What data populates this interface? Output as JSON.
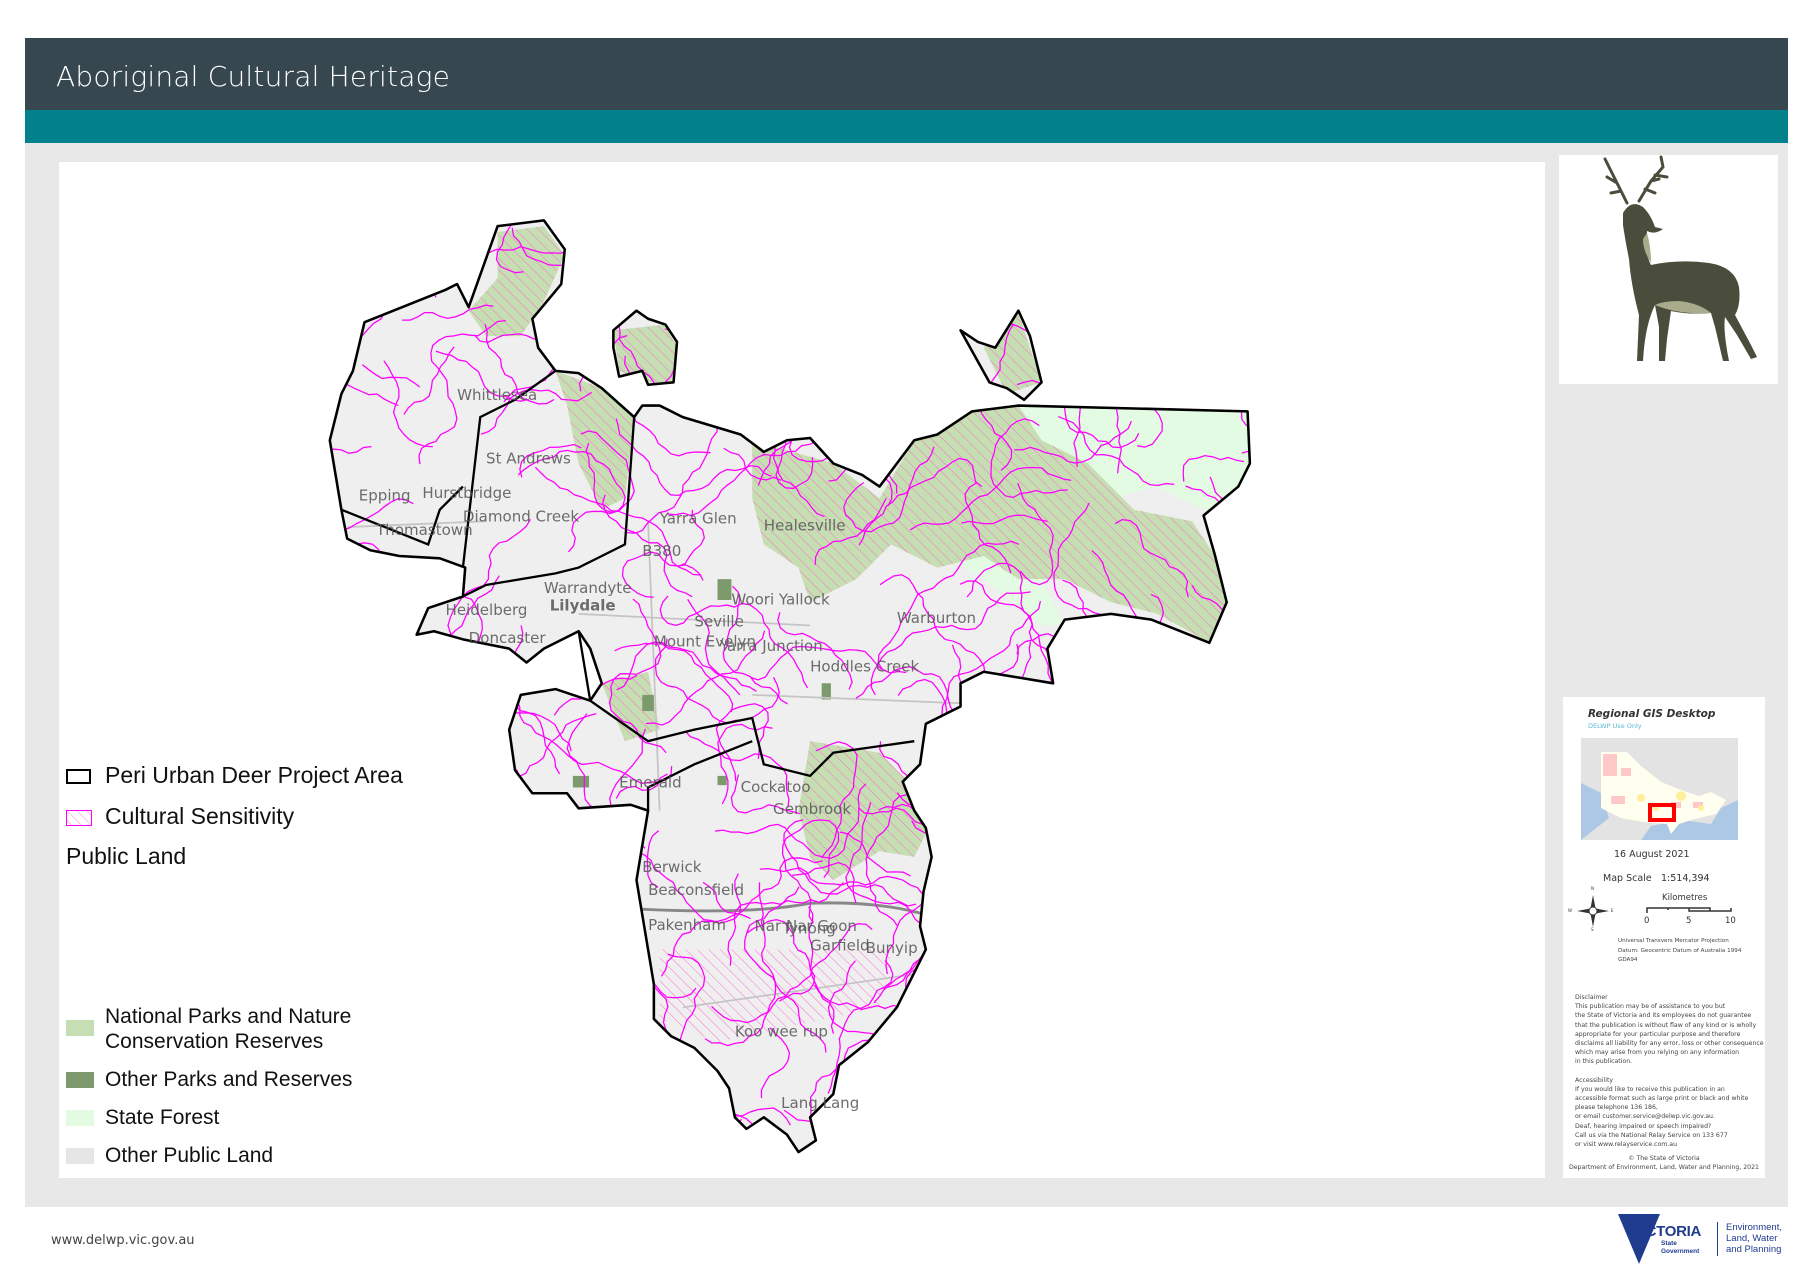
{
  "header": {
    "title": "Aboriginal Cultural Heritage"
  },
  "colors": {
    "header": "#37474f",
    "accent": "#00818c",
    "background": "#e8e8e8",
    "cultural_sensitivity": "#ff00ff",
    "national_parks": "#c5dfb3",
    "other_parks": "#7c9a6c",
    "state_forest": "#e2fbe2",
    "other_public_land": "#e6e6e6"
  },
  "legend": {
    "project_area": "Peri Urban Deer Project Area",
    "cultural": "Cultural Sensitivity",
    "public_land": "Public Land",
    "national_parks_1": "National Parks and Nature",
    "national_parks_2": "Conservation Reserves",
    "other_parks": "Other Parks and Reserves",
    "state_forest": "State Forest",
    "other_public": "Other Public Land"
  },
  "map_labels": [
    "Whittlesea",
    "St Andrews",
    "Hurstbridge",
    "Diamond Creek",
    "Epping",
    "Thomastown",
    "Yarra Glen",
    "Healesville",
    "Warrandyte",
    "Lilydale",
    "Heidelberg",
    "Doncaster",
    "Seville",
    "Mount Evelyn",
    "Yarra Junction",
    "Woori Yallock",
    "Hoddles Creek",
    "Warburton",
    "Emerald",
    "Cockatoo",
    "Gembrook",
    "Berwick",
    "Beaconsfield",
    "Pakenham",
    "Nar Nar Goon",
    "Tynong",
    "Garfield",
    "Bunyip",
    "Koo wee rup",
    "Lang Lang",
    "B380"
  ],
  "info": {
    "title": "Regional GIS Desktop",
    "subtitle": "DELWP Use Only",
    "date": "16 August 2021",
    "scale_label": "Map Scale",
    "scale_value": "1:514,394",
    "units": "Kilometres",
    "ticks": [
      "0",
      "5",
      "10"
    ],
    "compass": [
      "N",
      "S",
      "E",
      "W"
    ],
    "projection": [
      "Universal Transvers Mercator Projection",
      "Datum: Geocentric Datum of Australia 1994",
      "GDA94"
    ],
    "disclaimer_title": "Disclaimer",
    "disclaimer": [
      "This publication may be of assistance to you but",
      "the State of Victoria and its employees do not guarantee",
      "that the publication is without flaw of any kind or is wholly",
      "appropriate for your particular purpose and therefore",
      "disclaims all liability for any error, loss or other consequence",
      "which may arise from you relying on any information",
      "in this publication."
    ],
    "accessibility_title": "Accessibility",
    "accessibility": [
      "If you would like to receive this publication in an",
      "accessible format such as large print or black and white",
      "please telephone 136 186,",
      "or email customer.service@delwp.vic.gov.au.",
      "Deaf, hearing impaired or speech impaired?",
      "Call us via the National Relay Service on 133 677",
      "or visit www.relayservice.com.au"
    ],
    "copyright": "© The State of Victoria",
    "department": "Department of Environment, Land, Water and Planning, 2021"
  },
  "footer": {
    "url": "www.delwp.vic.gov.au",
    "logo_main": "VICTORIA",
    "logo_sub1": "State",
    "logo_sub2": "Government",
    "dept1": "Environment,",
    "dept2": "Land, Water",
    "dept3": "and Planning"
  }
}
